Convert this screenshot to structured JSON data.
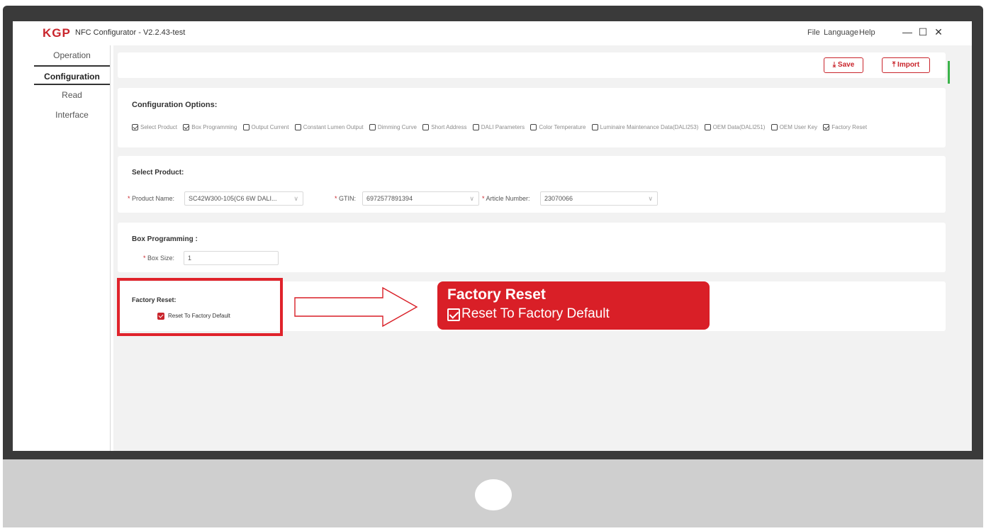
{
  "window": {
    "logo": "KGP",
    "title": "NFC Configurator - V2.2.43-test",
    "menu": [
      "File",
      "Language",
      "Help"
    ],
    "controls": [
      "—",
      "☐",
      "✕"
    ]
  },
  "sidebar": {
    "items": [
      {
        "label": "Operation",
        "active": false
      },
      {
        "label": "Configuration",
        "active": true
      },
      {
        "label": "Read",
        "active": false
      },
      {
        "label": "Interface",
        "active": false
      }
    ]
  },
  "toolbar": {
    "save_label": "Save",
    "import_label": "Import",
    "save_icon": "download-icon",
    "import_icon": "upload-icon"
  },
  "config_options": {
    "title": "Configuration Options:",
    "options": [
      {
        "label": "Select Product",
        "checked": true
      },
      {
        "label": "Box Programming",
        "checked": true
      },
      {
        "label": "Output Current",
        "checked": false
      },
      {
        "label": "Constant Lumen Output",
        "checked": false
      },
      {
        "label": "Dimming Curve",
        "checked": false
      },
      {
        "label": "Short Address",
        "checked": false
      },
      {
        "label": "DALI Parameters",
        "checked": false
      },
      {
        "label": "Color Temperature",
        "checked": false
      },
      {
        "label": "Luminaire Maintenance Data(DALI253)",
        "checked": false
      },
      {
        "label": "OEM Data(DALI251)",
        "checked": false
      },
      {
        "label": "OEM User Key",
        "checked": false
      },
      {
        "label": "Factory Reset",
        "checked": true
      }
    ]
  },
  "select_product": {
    "title": "Select Product:",
    "product_name_label": "Product Name:",
    "product_name_value": "SC42W300-105(C6 6W DALI...",
    "gtin_label": "GTIN:",
    "gtin_value": "6972577891394",
    "article_label": "Article Number:",
    "article_value": "23070066"
  },
  "box_programming": {
    "title": "Box Programming :",
    "box_size_label": "Box Size:",
    "box_size_value": "1"
  },
  "factory_reset": {
    "title": "Factory Reset:",
    "checkbox_label": "Reset To Factory Default",
    "checked": true
  },
  "callout": {
    "title": "Factory Reset",
    "item": "Reset To Factory Default"
  },
  "colors": {
    "accent": "#c9252c",
    "highlight": "#e0232b",
    "scroll": "#3bb34a"
  }
}
